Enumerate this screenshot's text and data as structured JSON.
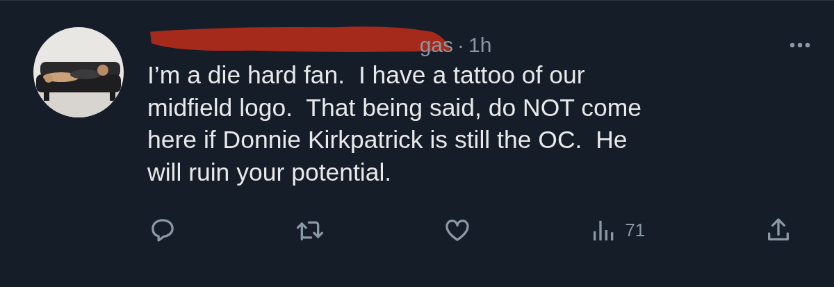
{
  "post": {
    "handle_fragment": "gas",
    "separator": "·",
    "time": "1h",
    "redacted": true,
    "text": "I’m a die hard fan.  I have a tattoo of our\nmidfield logo.  That being said, do NOT come\nhere if Donnie Kirkpatrick is still the OC.  He\nwill ruin your potential.",
    "views": "71"
  }
}
